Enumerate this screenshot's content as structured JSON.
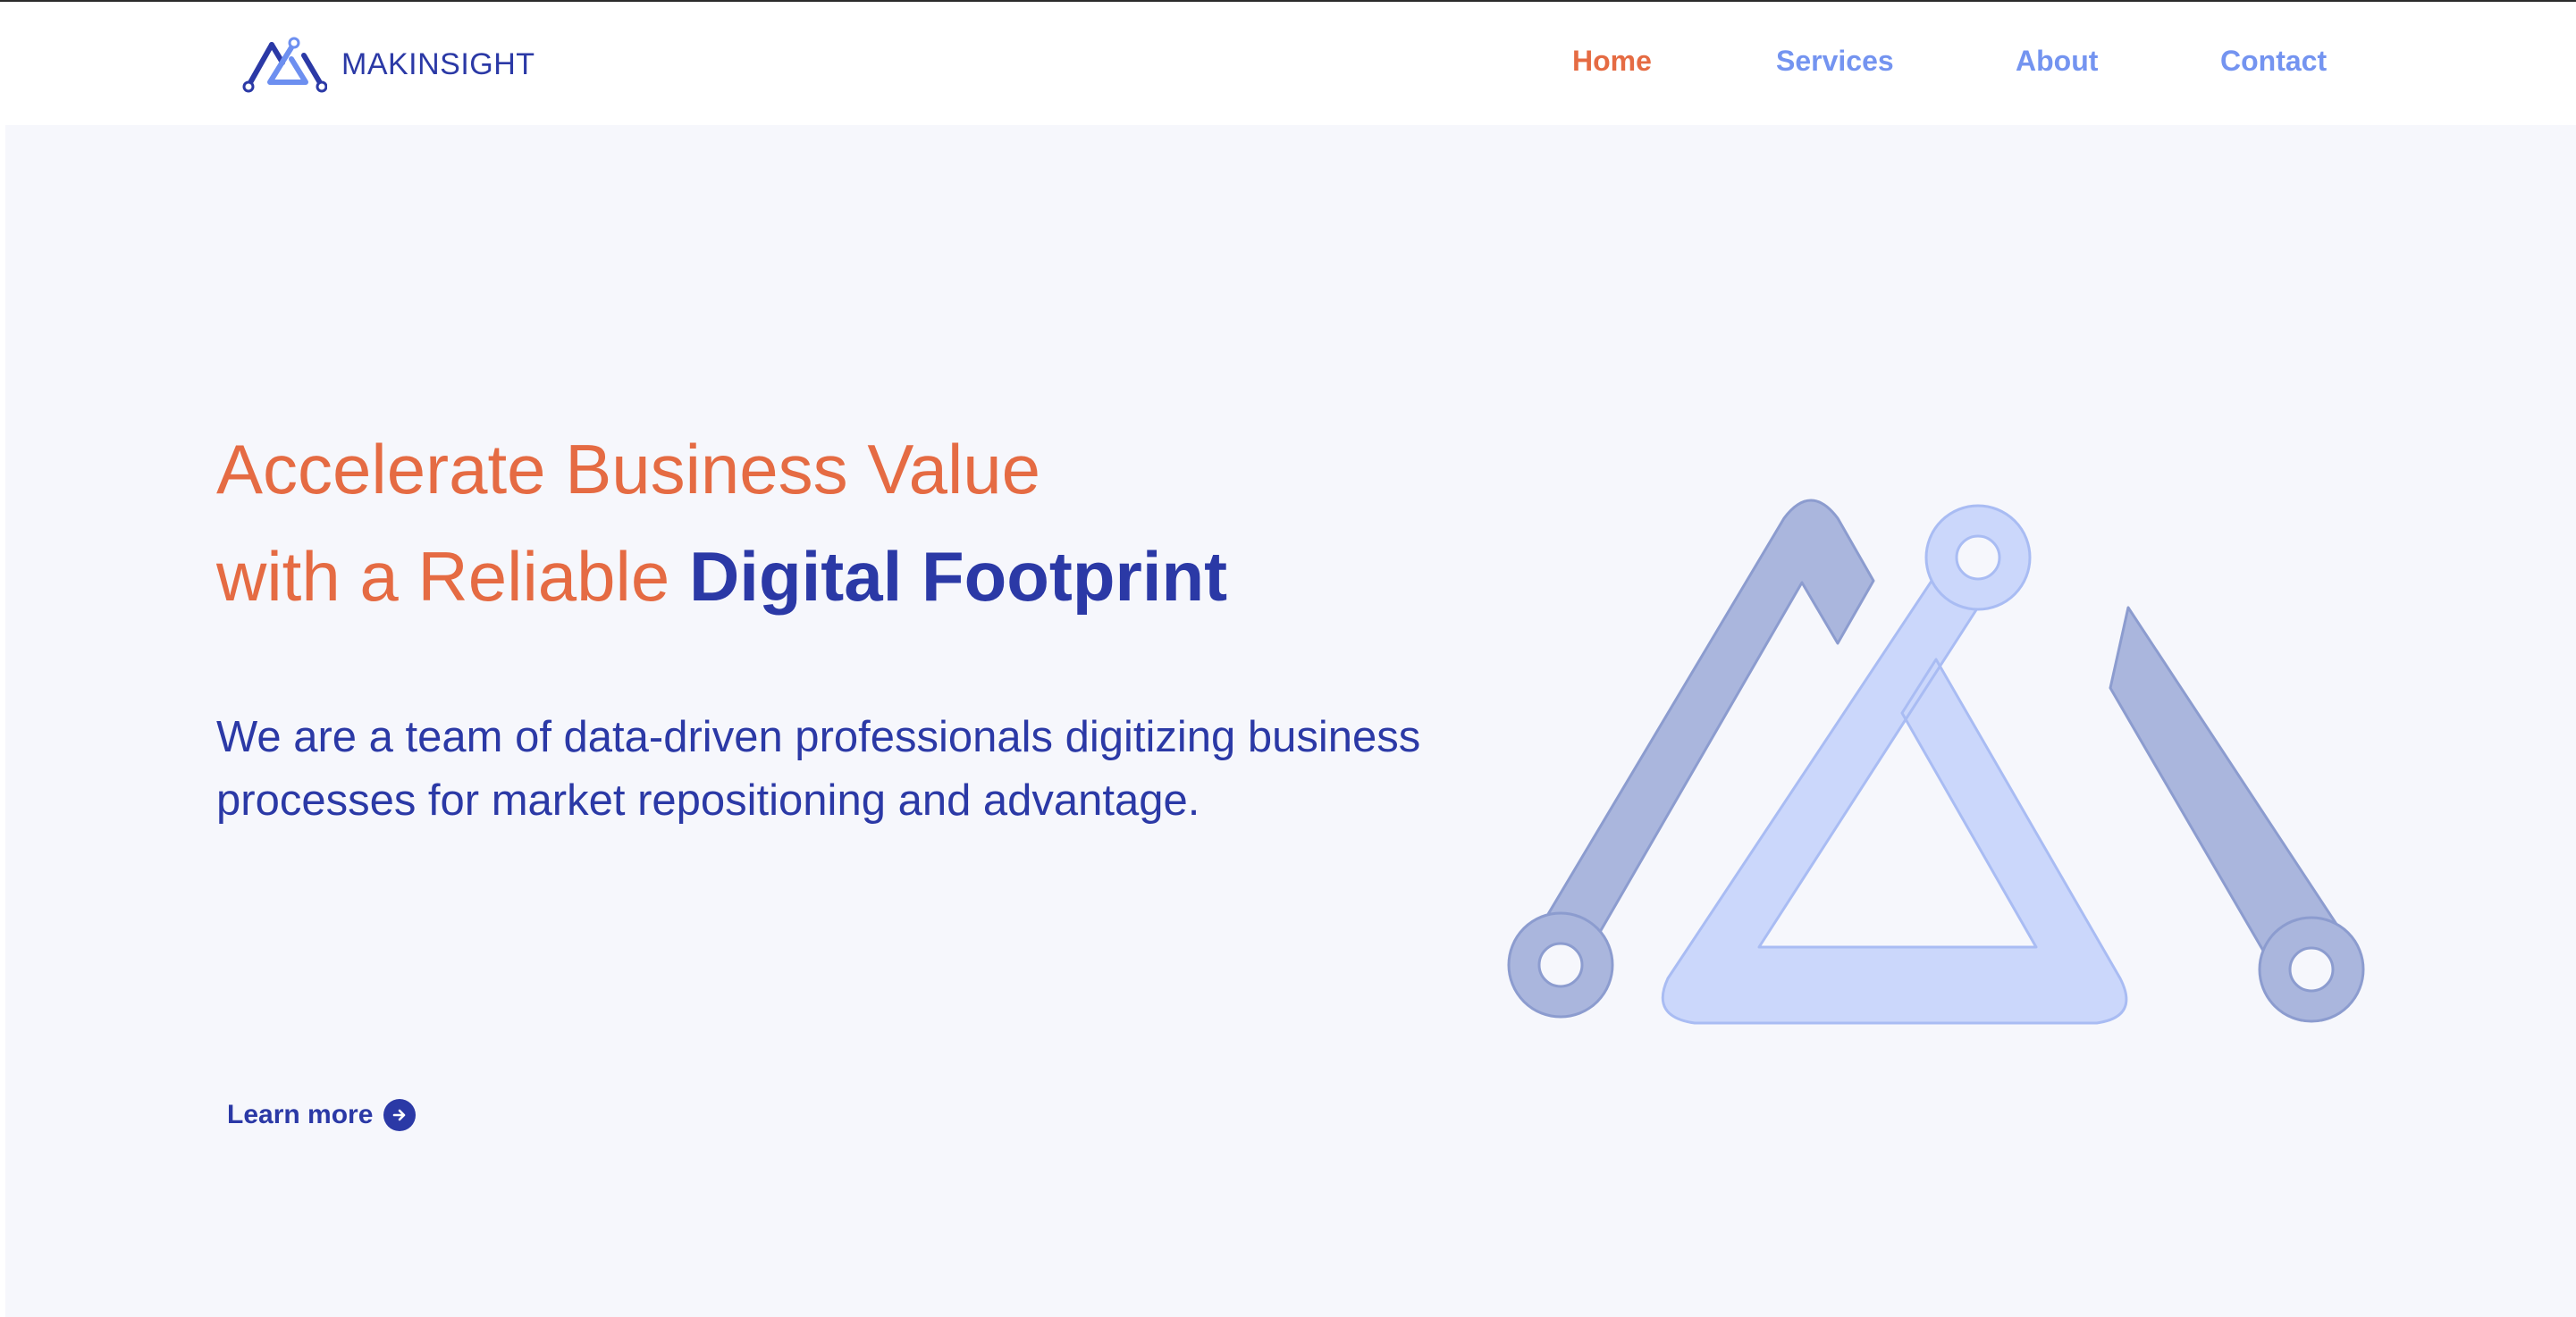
{
  "brand": {
    "name": "MAKINSIGHT",
    "logo_icon": "mountain-circuit-logo-icon",
    "color_primary": "#2b39a6",
    "color_accent": "#e56b43",
    "color_light": "#7494f0"
  },
  "nav": {
    "items": [
      {
        "label": "Home",
        "active": true
      },
      {
        "label": "Services",
        "active": false
      },
      {
        "label": "About",
        "active": false
      },
      {
        "label": "Contact",
        "active": false
      }
    ]
  },
  "hero": {
    "headline_line1": "Accelerate Business Value",
    "headline_line2_plain": "with a Reliable ",
    "headline_line2_strong": "Digital Footprint",
    "subtitle": "We are a team of data-driven professionals digitizing business processes for market repositioning and advantage.",
    "cta_label": "Learn more",
    "cta_icon": "arrow-right-circle-icon",
    "illustration_icon": "large-mountain-circuit-logo-icon"
  }
}
